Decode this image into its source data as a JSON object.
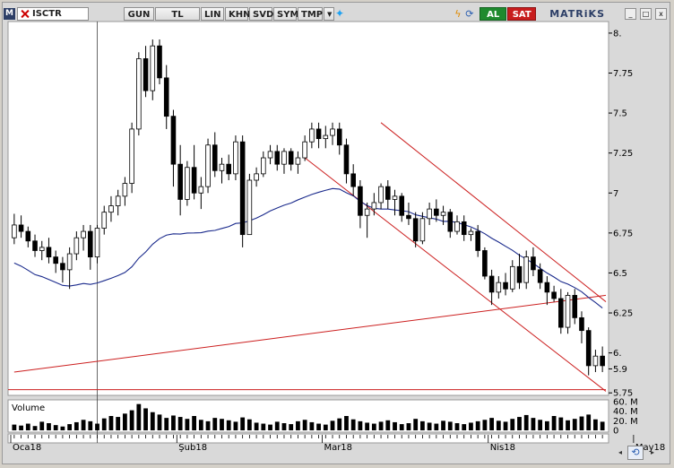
{
  "toolbar": {
    "badge": "M",
    "symbol": "ISCTR",
    "buttons": [
      "GUN",
      "TL",
      "LIN",
      "KHN",
      "SVD",
      "SYM",
      "TMP"
    ],
    "buy_label": "AL",
    "sell_label": "SAT",
    "brand": "MATRiKS"
  },
  "colors": {
    "candle_up": "#ffffff",
    "candle_down": "#000000",
    "moving_average": "#1a2a8c",
    "trend_lines": "#cc1f1f",
    "background": "#ffffff",
    "volume_bar": "#000000"
  },
  "chart_data": {
    "type": "candlestick",
    "symbol": "ISCTR",
    "y_ticks": [
      "8.",
      "7.75",
      "7.5",
      "7.25",
      "7",
      "6.75",
      "6.5",
      "6.25",
      "6.",
      "5.9",
      "5.75"
    ],
    "ylim": [
      5.74,
      8.05
    ],
    "x_labels": [
      "Oca18",
      "Şub18",
      "Mar18",
      "Nis18",
      "May18"
    ],
    "x_label_index": [
      0,
      24,
      45,
      69,
      90
    ],
    "volume": {
      "title": "Volume",
      "ticks": [
        "60. M",
        "40. M",
        "20. M",
        "0"
      ],
      "ylim": [
        0,
        60
      ]
    },
    "ohlc": [
      [
        6.72,
        6.87,
        6.68,
        6.8
      ],
      [
        6.8,
        6.86,
        6.72,
        6.76
      ],
      [
        6.76,
        6.79,
        6.66,
        6.7
      ],
      [
        6.7,
        6.74,
        6.6,
        6.64
      ],
      [
        6.64,
        6.7,
        6.58,
        6.66
      ],
      [
        6.66,
        6.72,
        6.56,
        6.6
      ],
      [
        6.6,
        6.64,
        6.5,
        6.56
      ],
      [
        6.56,
        6.6,
        6.44,
        6.52
      ],
      [
        6.52,
        6.66,
        6.4,
        6.62
      ],
      [
        6.62,
        6.76,
        6.58,
        6.72
      ],
      [
        6.72,
        6.8,
        6.64,
        6.76
      ],
      [
        6.76,
        6.8,
        6.52,
        6.6
      ],
      [
        6.6,
        6.8,
        6.56,
        6.78
      ],
      [
        6.78,
        6.92,
        6.74,
        6.88
      ],
      [
        6.88,
        6.98,
        6.82,
        6.92
      ],
      [
        6.92,
        7.02,
        6.86,
        6.98
      ],
      [
        6.98,
        7.1,
        6.92,
        7.06
      ],
      [
        7.06,
        7.44,
        7.0,
        7.4
      ],
      [
        7.4,
        7.88,
        7.36,
        7.84
      ],
      [
        7.84,
        7.92,
        7.6,
        7.64
      ],
      [
        7.64,
        7.96,
        7.58,
        7.92
      ],
      [
        7.92,
        7.96,
        7.68,
        7.72
      ],
      [
        7.72,
        7.8,
        7.4,
        7.48
      ],
      [
        7.48,
        7.52,
        7.04,
        7.18
      ],
      [
        7.18,
        7.3,
        6.86,
        6.96
      ],
      [
        6.96,
        7.2,
        6.92,
        7.16
      ],
      [
        7.16,
        7.3,
        6.96,
        7.0
      ],
      [
        7.0,
        7.1,
        6.9,
        7.04
      ],
      [
        7.04,
        7.34,
        7.0,
        7.3
      ],
      [
        7.3,
        7.38,
        7.1,
        7.14
      ],
      [
        7.14,
        7.22,
        7.06,
        7.18
      ],
      [
        7.18,
        7.24,
        7.08,
        7.12
      ],
      [
        7.12,
        7.36,
        7.08,
        7.32
      ],
      [
        7.32,
        7.36,
        6.66,
        6.74
      ],
      [
        6.74,
        7.12,
        6.9,
        7.08
      ],
      [
        7.08,
        7.16,
        7.04,
        7.12
      ],
      [
        7.12,
        7.26,
        7.1,
        7.22
      ],
      [
        7.22,
        7.3,
        7.18,
        7.26
      ],
      [
        7.26,
        7.3,
        7.14,
        7.18
      ],
      [
        7.18,
        7.28,
        7.12,
        7.26
      ],
      [
        7.26,
        7.28,
        7.14,
        7.18
      ],
      [
        7.18,
        7.26,
        7.12,
        7.22
      ],
      [
        7.22,
        7.36,
        7.2,
        7.32
      ],
      [
        7.32,
        7.44,
        7.28,
        7.4
      ],
      [
        7.4,
        7.44,
        7.28,
        7.34
      ],
      [
        7.34,
        7.42,
        7.28,
        7.36
      ],
      [
        7.36,
        7.44,
        7.3,
        7.4
      ],
      [
        7.4,
        7.44,
        7.24,
        7.3
      ],
      [
        7.3,
        7.34,
        7.06,
        7.12
      ],
      [
        7.12,
        7.18,
        6.98,
        7.04
      ],
      [
        7.04,
        7.08,
        6.78,
        6.86
      ],
      [
        6.86,
        6.94,
        6.72,
        6.9
      ],
      [
        6.9,
        7.0,
        6.86,
        6.94
      ],
      [
        6.94,
        7.06,
        6.9,
        7.04
      ],
      [
        7.04,
        7.08,
        6.9,
        6.96
      ],
      [
        6.96,
        7.02,
        6.86,
        6.98
      ],
      [
        6.98,
        7.0,
        6.82,
        6.86
      ],
      [
        6.86,
        6.94,
        6.8,
        6.84
      ],
      [
        6.84,
        6.88,
        6.66,
        6.7
      ],
      [
        6.7,
        6.88,
        6.68,
        6.84
      ],
      [
        6.84,
        6.94,
        6.8,
        6.9
      ],
      [
        6.9,
        6.96,
        6.82,
        6.86
      ],
      [
        6.86,
        6.92,
        6.8,
        6.88
      ],
      [
        6.88,
        6.9,
        6.72,
        6.76
      ],
      [
        6.76,
        6.86,
        6.74,
        6.82
      ],
      [
        6.82,
        6.86,
        6.7,
        6.74
      ],
      [
        6.74,
        6.78,
        6.7,
        6.76
      ],
      [
        6.76,
        6.8,
        6.6,
        6.64
      ],
      [
        6.64,
        6.66,
        6.46,
        6.48
      ],
      [
        6.48,
        6.52,
        6.3,
        6.38
      ],
      [
        6.38,
        6.48,
        6.34,
        6.44
      ],
      [
        6.44,
        6.5,
        6.36,
        6.4
      ],
      [
        6.4,
        6.58,
        6.38,
        6.54
      ],
      [
        6.54,
        6.62,
        6.4,
        6.44
      ],
      [
        6.44,
        6.64,
        6.4,
        6.6
      ],
      [
        6.6,
        6.66,
        6.48,
        6.52
      ],
      [
        6.52,
        6.56,
        6.4,
        6.44
      ],
      [
        6.44,
        6.48,
        6.3,
        6.38
      ],
      [
        6.38,
        6.42,
        6.32,
        6.34
      ],
      [
        6.34,
        6.4,
        6.12,
        6.16
      ],
      [
        6.16,
        6.38,
        6.12,
        6.36
      ],
      [
        6.36,
        6.4,
        6.18,
        6.22
      ],
      [
        6.22,
        6.26,
        6.06,
        6.14
      ],
      [
        6.14,
        6.16,
        5.86,
        5.92
      ],
      [
        5.92,
        6.02,
        5.88,
        5.98
      ],
      [
        5.98,
        6.04,
        5.88,
        5.92
      ]
    ],
    "volume_values": [
      12,
      10,
      14,
      9,
      18,
      15,
      11,
      8,
      13,
      17,
      22,
      19,
      14,
      25,
      30,
      28,
      35,
      42,
      55,
      46,
      38,
      33,
      26,
      31,
      28,
      24,
      30,
      22,
      19,
      26,
      24,
      21,
      18,
      27,
      23,
      16,
      14,
      12,
      18,
      15,
      13,
      19,
      22,
      17,
      14,
      12,
      20,
      25,
      30,
      23,
      19,
      16,
      14,
      18,
      21,
      17,
      13,
      15,
      24,
      19,
      16,
      14,
      20,
      18,
      15,
      13,
      16,
      19,
      22,
      26,
      20,
      18,
      24,
      28,
      32,
      26,
      22,
      19,
      30,
      27,
      21,
      24,
      29,
      33,
      23,
      18
    ]
  }
}
